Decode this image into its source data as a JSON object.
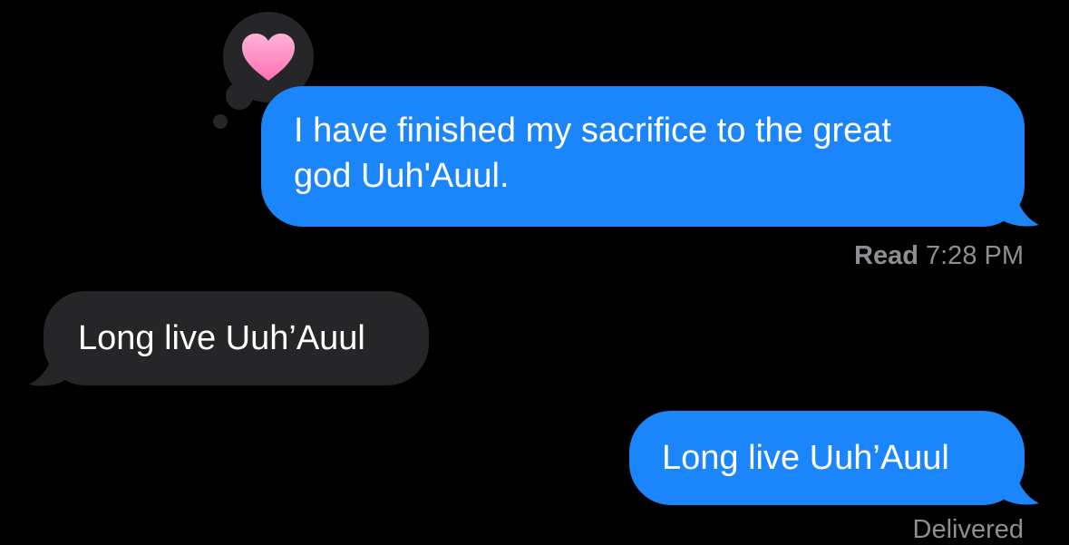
{
  "colors": {
    "background": "#000000",
    "sent_bubble": "#1b86fb",
    "received_bubble": "#262628",
    "meta_text": "#8e8e93",
    "tapback_heart": "#ff7fbf"
  },
  "messages": [
    {
      "direction": "sent",
      "text": "I have finished my sacrifice to the great god Uuh'Auul.",
      "lines": [
        "I have finished my sacrifice to the great",
        "god Uuh'Auul."
      ],
      "tapback": "heart-icon"
    },
    {
      "direction": "received",
      "text": "Long live Uuh’Auul"
    },
    {
      "direction": "sent",
      "text": "Long live Uuh’Auul"
    }
  ],
  "receipts": {
    "read_label": "Read",
    "read_time": "7:28 PM",
    "delivered": "Delivered"
  }
}
